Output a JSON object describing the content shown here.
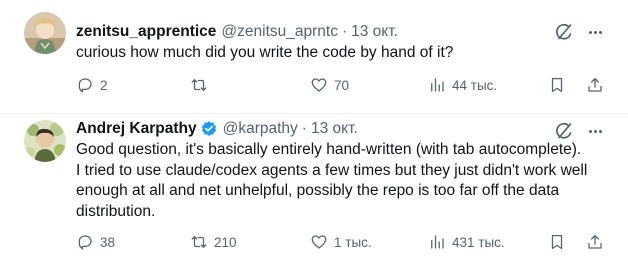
{
  "tweets": [
    {
      "author": {
        "name": "zenitsu_apprentice",
        "handle": "@zenitsu_aprntc",
        "separator": "·",
        "date": "13 окт."
      },
      "text_lines": [
        "curious how much did you write the code by hand of it?"
      ],
      "stats": {
        "replies": "2",
        "retweets": "",
        "likes": "70",
        "views": "44 тыс."
      },
      "icons": [
        "reply-icon",
        "retweet-icon",
        "like-icon",
        "views-icon",
        "bookmark-icon",
        "share-icon",
        "grok-icon",
        "more-icon"
      ]
    },
    {
      "author": {
        "name": "Andrej Karpathy",
        "handle": "@karpathy",
        "separator": "·",
        "date": "13 окт."
      },
      "text_lines": [
        "Good question, it's basically entirely hand-written (with tab autocomplete).",
        "I tried to use claude/codex agents a few times but they just didn't work well",
        "enough at all and net unhelpful, possibly the repo is too far off the data",
        "distribution."
      ],
      "stats": {
        "replies": "38",
        "retweets": "210",
        "likes": "1 тыс.",
        "views": "431 тыс."
      },
      "icons": [
        "verified-badge-icon",
        "reply-icon",
        "retweet-icon",
        "like-icon",
        "views-icon",
        "bookmark-icon",
        "share-icon",
        "grok-icon",
        "more-icon"
      ]
    }
  ],
  "colors": {
    "text": "#0f1419",
    "secondary": "#536471",
    "verified": "#1d9bf0",
    "divider": "#eff3f4"
  }
}
